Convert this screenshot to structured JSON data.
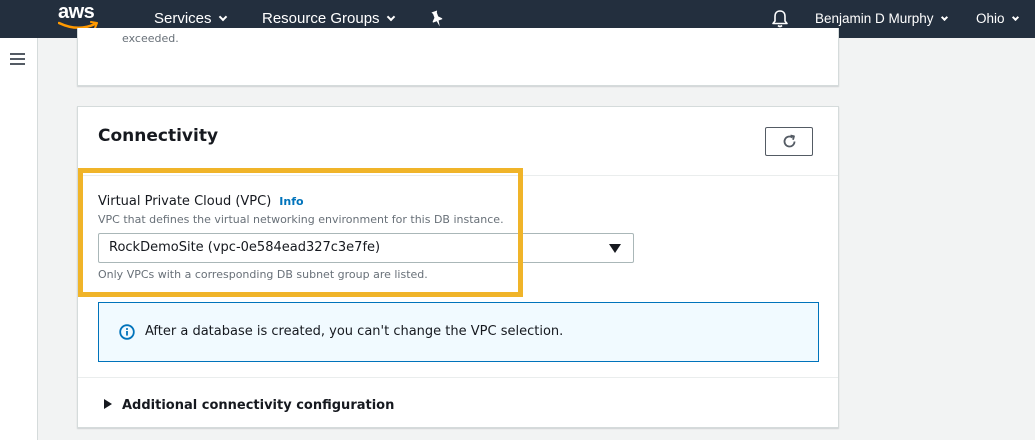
{
  "topnav": {
    "logo_text": "aws",
    "services_label": "Services",
    "resource_groups_label": "Resource Groups",
    "user_name": "Benjamin D Murphy",
    "region": "Ohio",
    "bg_color": "#232f3e"
  },
  "previous_panel": {
    "text": "exceeded."
  },
  "connectivity": {
    "title": "Connectivity",
    "vpc": {
      "label": "Virtual Private Cloud (VPC)",
      "info_link": "Info",
      "description": "VPC that defines the virtual networking environment for this DB instance.",
      "selected_value": "RockDemoSite (vpc-0e584ead327c3e7fe)",
      "constraint_text": "Only VPCs with a corresponding DB subnet group are listed."
    },
    "alert_text": "After a database is created, you can't change the VPC selection.",
    "additional_config_label": "Additional connectivity configuration"
  },
  "colors": {
    "highlight": "#f0b429",
    "link": "#0073bb",
    "alert_bg": "#f1faff"
  }
}
